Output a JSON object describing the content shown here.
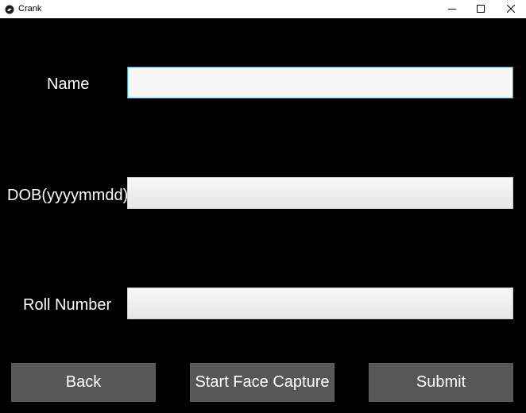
{
  "window": {
    "title": "Crank",
    "app_icon": "kivy-icon",
    "controls": {
      "minimize_icon": "minimize-icon",
      "maximize_icon": "maximize-icon",
      "close_icon": "close-icon"
    }
  },
  "form": {
    "name_label": "Name",
    "name_value": "",
    "dob_label": "DOB(yyyymmdd)",
    "dob_value": "",
    "roll_label": "Roll Number",
    "roll_value": ""
  },
  "actions": {
    "back_label": "Back",
    "capture_label": "Start Face Capture",
    "submit_label": "Submit"
  },
  "colors": {
    "background": "#000000",
    "button": "#575757",
    "focus_border": "#33a6d6",
    "input": "#f7f7f7"
  }
}
